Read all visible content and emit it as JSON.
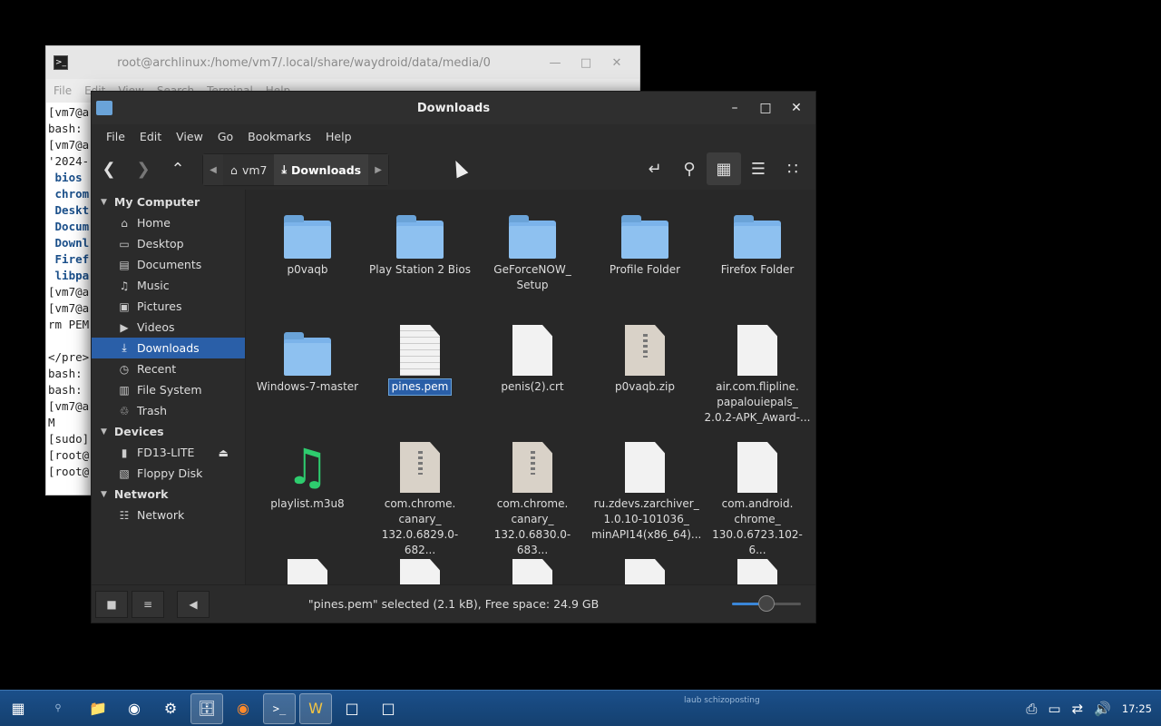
{
  "terminal": {
    "title": "root@archlinux:/home/vm7/.local/share/waydroid/data/media/0",
    "menu": [
      "File",
      "Edit",
      "View",
      "Search",
      "Terminal",
      "Help"
    ],
    "lines": [
      "[vm7@a",
      "bash: ",
      "[vm7@a",
      "'2024-",
      " bios",
      " chrom",
      " Deskt",
      " Docum",
      " Downl",
      " Firef",
      " libpa",
      "[vm7@a",
      "[vm7@a",
      "rm PEM",
      "",
      "</pre>",
      "bash: ",
      "bash: ",
      "[vm7@a",
      "M",
      "[sudo]",
      "[root@",
      "[root@"
    ]
  },
  "fm": {
    "title": "Downloads",
    "menu": [
      "File",
      "Edit",
      "View",
      "Go",
      "Bookmarks",
      "Help"
    ],
    "breadcrumb": {
      "home": "vm7",
      "current": "Downloads"
    },
    "sidebar": {
      "my_computer": "My Computer",
      "places": [
        {
          "label": "Home",
          "icon": "home-icon"
        },
        {
          "label": "Desktop",
          "icon": "folder-icon"
        },
        {
          "label": "Documents",
          "icon": "documents-icon"
        },
        {
          "label": "Music",
          "icon": "music-icon"
        },
        {
          "label": "Pictures",
          "icon": "pictures-icon"
        },
        {
          "label": "Videos",
          "icon": "videos-icon"
        },
        {
          "label": "Downloads",
          "icon": "download-icon"
        },
        {
          "label": "Recent",
          "icon": "recent-icon"
        },
        {
          "label": "File System",
          "icon": "drive-icon"
        },
        {
          "label": "Trash",
          "icon": "trash-icon"
        }
      ],
      "devices_header": "Devices",
      "devices": [
        {
          "label": "FD13-LITE",
          "icon": "usb-icon"
        },
        {
          "label": "Floppy Disk",
          "icon": "floppy-icon"
        }
      ],
      "network_header": "Network",
      "network": [
        {
          "label": "Network",
          "icon": "network-icon"
        }
      ]
    },
    "files": [
      {
        "name": "p0vaqb",
        "type": "folder"
      },
      {
        "name": "Play Station 2 Bios",
        "type": "folder"
      },
      {
        "name": "GeForceNOW_\nSetup",
        "type": "folder"
      },
      {
        "name": "Profile Folder",
        "type": "folder"
      },
      {
        "name": "Firefox Folder",
        "type": "folder"
      },
      {
        "name": "Windows-7-master",
        "type": "folder"
      },
      {
        "name": "pines.pem",
        "type": "text",
        "selected": true
      },
      {
        "name": "penis(2).crt",
        "type": "doc"
      },
      {
        "name": "p0vaqb.zip",
        "type": "zip"
      },
      {
        "name": "air.com.flipline.\npapalouiepals_\n2.0.2-APK_Award-...",
        "type": "doc"
      },
      {
        "name": "playlist.m3u8",
        "type": "music"
      },
      {
        "name": "com.chrome.\ncanary_\n132.0.6829.0-682...",
        "type": "zip"
      },
      {
        "name": "com.chrome.\ncanary_\n132.0.6830.0-683...",
        "type": "zip"
      },
      {
        "name": "ru.zdevs.zarchiver_\n1.0.10-101036_\nminAPI14(x86_64)...",
        "type": "doc"
      },
      {
        "name": "com.android.\nchrome_\n130.0.6723.102-6...",
        "type": "doc"
      },
      {
        "name": "",
        "type": "doc"
      },
      {
        "name": "",
        "type": "doc"
      },
      {
        "name": "",
        "type": "doc"
      },
      {
        "name": "",
        "type": "doc"
      },
      {
        "name": "",
        "type": "doc"
      }
    ],
    "status": "\"pines.pem\" selected (2.1 kB), Free space: 24.9 GB",
    "zoom_fraction": 0.5,
    "accent_color": "#2a5fa8"
  },
  "taskbar": {
    "time": "17:25",
    "tray_note": "laub schizoposting"
  }
}
